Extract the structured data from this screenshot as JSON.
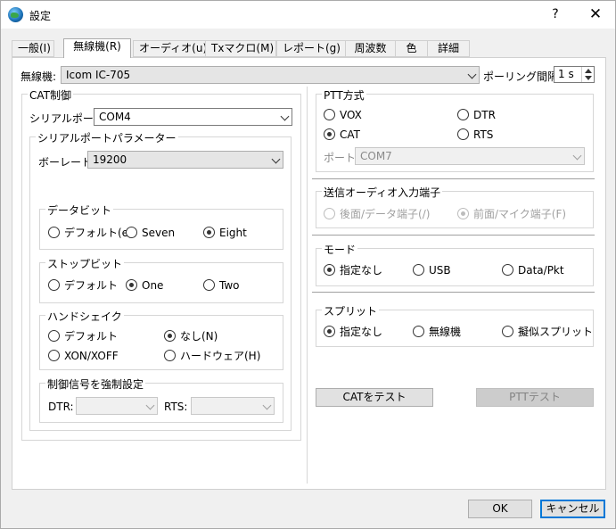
{
  "window": {
    "title": "設定",
    "help": "?",
    "close": "✕"
  },
  "tabs": [
    "一般(I)",
    "無線機(R)",
    "オーディオ(u)",
    "Txマクロ(M)",
    "レポート(g)",
    "周波数",
    "色",
    "詳細"
  ],
  "radio_select": {
    "label": "無線機:",
    "value": "Icom IC-705"
  },
  "polling": {
    "label": "ポーリング間隔:",
    "value": "1 s"
  },
  "cat": {
    "title": "CAT制御",
    "port_label": "シリアルポート:",
    "port_value": "COM4",
    "params_title": "シリアルポートパラメーター",
    "baud_label": "ボーレート:",
    "baud_value": "19200",
    "databits": {
      "title": "データビット",
      "options": [
        "デフォルト(e)",
        "Seven",
        "Eight"
      ]
    },
    "stopbits": {
      "title": "ストップビット",
      "options": [
        "デフォルト",
        "One",
        "Two"
      ]
    },
    "handshake": {
      "title": "ハンドシェイク",
      "options": [
        "デフォルト",
        "なし(N)",
        "XON/XOFF",
        "ハードウェア(H)"
      ]
    },
    "force": {
      "title": "制御信号を強制設定",
      "dtr_label": "DTR:",
      "rts_label": "RTS:"
    }
  },
  "ptt": {
    "title": "PTT方式",
    "options": [
      "VOX",
      "DTR",
      "CAT",
      "RTS"
    ],
    "port_label": "ポート:",
    "port_value": "COM7"
  },
  "tx_audio": {
    "title": "送信オーディオ入力端子",
    "options": [
      "後面/データ端子(/)",
      "前面/マイク端子(F)"
    ]
  },
  "mode": {
    "title": "モード",
    "options": [
      "指定なし",
      "USB",
      "Data/Pkt"
    ]
  },
  "split": {
    "title": "スプリット",
    "options": [
      "指定なし",
      "無線機",
      "擬似スプリット"
    ]
  },
  "buttons": {
    "test_cat": "CATをテスト",
    "test_ptt": "PTTテスト",
    "ok": "OK",
    "cancel": "キャンセル"
  }
}
